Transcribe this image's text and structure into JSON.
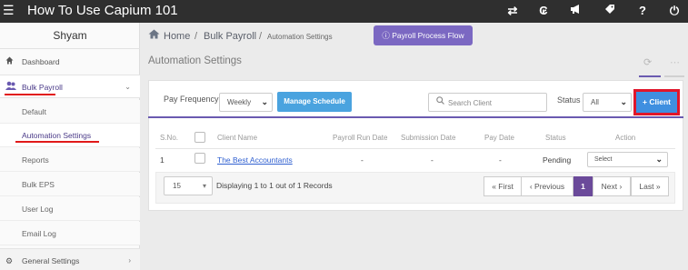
{
  "app": {
    "title": "How To Use Capium 101"
  },
  "topbar_icons": [
    "exchange-icon",
    "currency-icon",
    "megaphone-icon",
    "tag-icon",
    "help-icon",
    "power-icon"
  ],
  "sidebar": {
    "user": "Shyam",
    "items": {
      "dashboard": "Dashboard",
      "bulk_payroll": "Bulk Payroll",
      "general_settings": "General Settings"
    },
    "sub_items": [
      "Default",
      "Automation Settings",
      "Reports",
      "Bulk EPS",
      "User Log",
      "Email Log"
    ]
  },
  "breadcrumb": {
    "home": "Home",
    "section": "Bulk Payroll",
    "current": "Automation Settings"
  },
  "flow_button": "Payroll Process Flow",
  "panel": {
    "title": "Automation Settings"
  },
  "toolbar": {
    "pay_frequency_label": "Pay Frequency",
    "pay_frequency_value": "Weekly",
    "manage_schedule": "Manage Schedule",
    "search_placeholder": "Search Client",
    "status_label": "Status",
    "status_value": "All",
    "add_client": "+ Client"
  },
  "table": {
    "headers": {
      "sno": "S.No.",
      "client_name": "Client Name",
      "payroll_run_date": "Payroll Run Date",
      "submission_date": "Submission Date",
      "pay_date": "Pay Date",
      "status": "Status",
      "action": "Action"
    },
    "rows": [
      {
        "sno": "1",
        "client_name": "The Best Accountants",
        "payroll_run_date": "-",
        "submission_date": "-",
        "pay_date": "-",
        "status": "Pending",
        "action": "Select"
      }
    ]
  },
  "pagination": {
    "page_size": "15",
    "records_text": "Displaying 1 to 1 out of 1 Records",
    "first": "« First",
    "previous": "‹ Previous",
    "current_page": "1",
    "next": "Next ›",
    "last": "Last »"
  },
  "colors": {
    "topbar": "#2f2f2f",
    "accent_purple": "#6a5ab0",
    "flow_button": "#7b68c2",
    "manage_button": "#4aa3df",
    "client_button": "#3f8fe0",
    "highlight_red": "#e0162b",
    "active_page": "#6b4a9a"
  }
}
